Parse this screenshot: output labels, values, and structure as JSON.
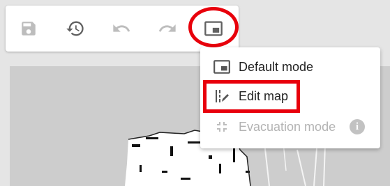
{
  "toolbar": {
    "buttons": [
      {
        "name": "save-button",
        "icon": "save-icon",
        "state": "disabled"
      },
      {
        "name": "history-button",
        "icon": "history-icon",
        "state": "enabled"
      },
      {
        "name": "undo-button",
        "icon": "undo-icon",
        "state": "disabled"
      },
      {
        "name": "redo-button",
        "icon": "redo-icon",
        "state": "disabled"
      },
      {
        "name": "mode-button",
        "icon": "picture-in-picture-icon",
        "state": "enabled"
      }
    ]
  },
  "mode_menu": {
    "items": [
      {
        "label": "Default mode",
        "icon": "picture-in-picture-icon",
        "enabled": true
      },
      {
        "label": "Edit map",
        "icon": "edit-map-icon",
        "enabled": true
      },
      {
        "label": "Evacuation mode",
        "icon": "compress-icon",
        "enabled": false,
        "info_icon": "info-icon",
        "info_glyph": "i"
      }
    ]
  },
  "colors": {
    "highlight": "#e8000b",
    "icon_enabled": "#616161",
    "icon_disabled": "#bdbdbd",
    "text": "#222222",
    "text_disabled": "#b3b3b3",
    "map_background": "#cdcdcd",
    "page_background": "#e5e5e5"
  }
}
